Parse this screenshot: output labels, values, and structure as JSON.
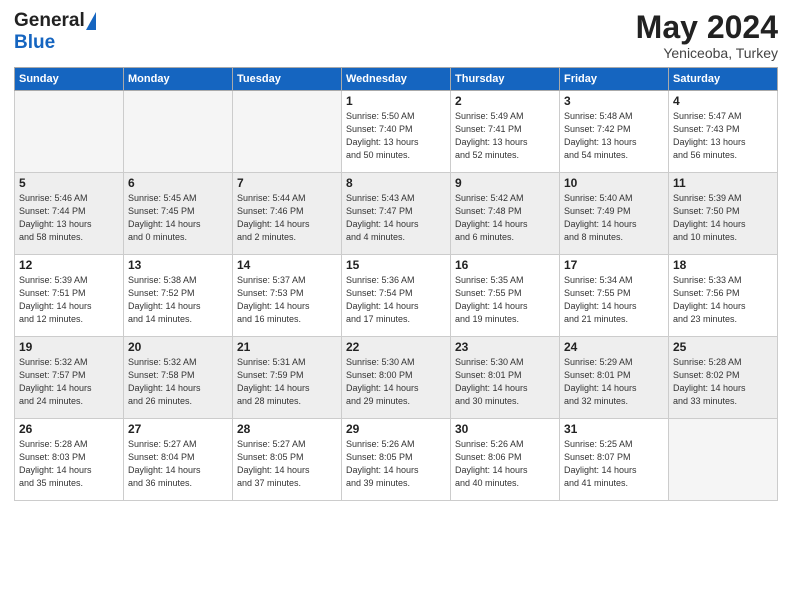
{
  "logo": {
    "general": "General",
    "blue": "Blue"
  },
  "title": {
    "month": "May 2024",
    "location": "Yeniceoba, Turkey"
  },
  "headers": [
    "Sunday",
    "Monday",
    "Tuesday",
    "Wednesday",
    "Thursday",
    "Friday",
    "Saturday"
  ],
  "weeks": [
    {
      "shaded": false,
      "days": [
        {
          "num": "",
          "info": ""
        },
        {
          "num": "",
          "info": ""
        },
        {
          "num": "",
          "info": ""
        },
        {
          "num": "1",
          "info": "Sunrise: 5:50 AM\nSunset: 7:40 PM\nDaylight: 13 hours\nand 50 minutes."
        },
        {
          "num": "2",
          "info": "Sunrise: 5:49 AM\nSunset: 7:41 PM\nDaylight: 13 hours\nand 52 minutes."
        },
        {
          "num": "3",
          "info": "Sunrise: 5:48 AM\nSunset: 7:42 PM\nDaylight: 13 hours\nand 54 minutes."
        },
        {
          "num": "4",
          "info": "Sunrise: 5:47 AM\nSunset: 7:43 PM\nDaylight: 13 hours\nand 56 minutes."
        }
      ]
    },
    {
      "shaded": true,
      "days": [
        {
          "num": "5",
          "info": "Sunrise: 5:46 AM\nSunset: 7:44 PM\nDaylight: 13 hours\nand 58 minutes."
        },
        {
          "num": "6",
          "info": "Sunrise: 5:45 AM\nSunset: 7:45 PM\nDaylight: 14 hours\nand 0 minutes."
        },
        {
          "num": "7",
          "info": "Sunrise: 5:44 AM\nSunset: 7:46 PM\nDaylight: 14 hours\nand 2 minutes."
        },
        {
          "num": "8",
          "info": "Sunrise: 5:43 AM\nSunset: 7:47 PM\nDaylight: 14 hours\nand 4 minutes."
        },
        {
          "num": "9",
          "info": "Sunrise: 5:42 AM\nSunset: 7:48 PM\nDaylight: 14 hours\nand 6 minutes."
        },
        {
          "num": "10",
          "info": "Sunrise: 5:40 AM\nSunset: 7:49 PM\nDaylight: 14 hours\nand 8 minutes."
        },
        {
          "num": "11",
          "info": "Sunrise: 5:39 AM\nSunset: 7:50 PM\nDaylight: 14 hours\nand 10 minutes."
        }
      ]
    },
    {
      "shaded": false,
      "days": [
        {
          "num": "12",
          "info": "Sunrise: 5:39 AM\nSunset: 7:51 PM\nDaylight: 14 hours\nand 12 minutes."
        },
        {
          "num": "13",
          "info": "Sunrise: 5:38 AM\nSunset: 7:52 PM\nDaylight: 14 hours\nand 14 minutes."
        },
        {
          "num": "14",
          "info": "Sunrise: 5:37 AM\nSunset: 7:53 PM\nDaylight: 14 hours\nand 16 minutes."
        },
        {
          "num": "15",
          "info": "Sunrise: 5:36 AM\nSunset: 7:54 PM\nDaylight: 14 hours\nand 17 minutes."
        },
        {
          "num": "16",
          "info": "Sunrise: 5:35 AM\nSunset: 7:55 PM\nDaylight: 14 hours\nand 19 minutes."
        },
        {
          "num": "17",
          "info": "Sunrise: 5:34 AM\nSunset: 7:55 PM\nDaylight: 14 hours\nand 21 minutes."
        },
        {
          "num": "18",
          "info": "Sunrise: 5:33 AM\nSunset: 7:56 PM\nDaylight: 14 hours\nand 23 minutes."
        }
      ]
    },
    {
      "shaded": true,
      "days": [
        {
          "num": "19",
          "info": "Sunrise: 5:32 AM\nSunset: 7:57 PM\nDaylight: 14 hours\nand 24 minutes."
        },
        {
          "num": "20",
          "info": "Sunrise: 5:32 AM\nSunset: 7:58 PM\nDaylight: 14 hours\nand 26 minutes."
        },
        {
          "num": "21",
          "info": "Sunrise: 5:31 AM\nSunset: 7:59 PM\nDaylight: 14 hours\nand 28 minutes."
        },
        {
          "num": "22",
          "info": "Sunrise: 5:30 AM\nSunset: 8:00 PM\nDaylight: 14 hours\nand 29 minutes."
        },
        {
          "num": "23",
          "info": "Sunrise: 5:30 AM\nSunset: 8:01 PM\nDaylight: 14 hours\nand 30 minutes."
        },
        {
          "num": "24",
          "info": "Sunrise: 5:29 AM\nSunset: 8:01 PM\nDaylight: 14 hours\nand 32 minutes."
        },
        {
          "num": "25",
          "info": "Sunrise: 5:28 AM\nSunset: 8:02 PM\nDaylight: 14 hours\nand 33 minutes."
        }
      ]
    },
    {
      "shaded": false,
      "days": [
        {
          "num": "26",
          "info": "Sunrise: 5:28 AM\nSunset: 8:03 PM\nDaylight: 14 hours\nand 35 minutes."
        },
        {
          "num": "27",
          "info": "Sunrise: 5:27 AM\nSunset: 8:04 PM\nDaylight: 14 hours\nand 36 minutes."
        },
        {
          "num": "28",
          "info": "Sunrise: 5:27 AM\nSunset: 8:05 PM\nDaylight: 14 hours\nand 37 minutes."
        },
        {
          "num": "29",
          "info": "Sunrise: 5:26 AM\nSunset: 8:05 PM\nDaylight: 14 hours\nand 39 minutes."
        },
        {
          "num": "30",
          "info": "Sunrise: 5:26 AM\nSunset: 8:06 PM\nDaylight: 14 hours\nand 40 minutes."
        },
        {
          "num": "31",
          "info": "Sunrise: 5:25 AM\nSunset: 8:07 PM\nDaylight: 14 hours\nand 41 minutes."
        },
        {
          "num": "",
          "info": ""
        }
      ]
    }
  ]
}
